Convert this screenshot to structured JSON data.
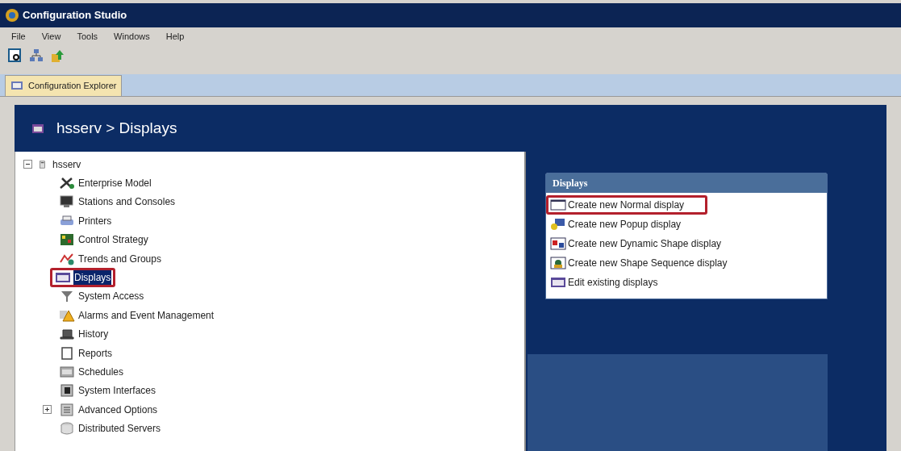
{
  "window": {
    "title": "Configuration Studio"
  },
  "menu": [
    "File",
    "View",
    "Tools",
    "Windows",
    "Help"
  ],
  "tabs": [
    {
      "label": "Configuration Explorer",
      "selected": true
    }
  ],
  "header": {
    "title": "hsserv > Displays"
  },
  "tree": [
    {
      "label": "hsserv",
      "expanded": true,
      "selected": false,
      "outlined": false,
      "children": [
        {
          "label": "Enterprise Model",
          "selected": false,
          "outlined": false
        },
        {
          "label": "Stations and Consoles",
          "selected": false,
          "outlined": false
        },
        {
          "label": "Printers",
          "selected": false,
          "outlined": false
        },
        {
          "label": "Control Strategy",
          "selected": false,
          "outlined": false
        },
        {
          "label": "Trends and Groups",
          "selected": false,
          "outlined": false
        },
        {
          "label": "Displays",
          "selected": true,
          "outlined": true
        },
        {
          "label": "System Access",
          "selected": false,
          "outlined": false
        },
        {
          "label": "Alarms and Event Management",
          "selected": false,
          "outlined": false
        },
        {
          "label": "History",
          "selected": false,
          "outlined": false
        },
        {
          "label": "Reports",
          "selected": false,
          "outlined": false
        },
        {
          "label": "Schedules",
          "selected": false,
          "outlined": false
        },
        {
          "label": "System Interfaces",
          "selected": false,
          "outlined": false
        },
        {
          "label": "Advanced Options",
          "expanded": false,
          "selected": false,
          "outlined": false
        },
        {
          "label": "Distributed Servers",
          "selected": false,
          "outlined": false
        }
      ]
    }
  ],
  "tasks": {
    "title": "Displays",
    "items": [
      {
        "label": "Create new Normal display",
        "outlined": true
      },
      {
        "label": "Create new Popup display",
        "outlined": false
      },
      {
        "label": "Create new Dynamic Shape display",
        "outlined": false
      },
      {
        "label": "Create new Shape Sequence display",
        "outlined": false
      },
      {
        "label": "Edit existing displays",
        "outlined": false
      }
    ]
  }
}
